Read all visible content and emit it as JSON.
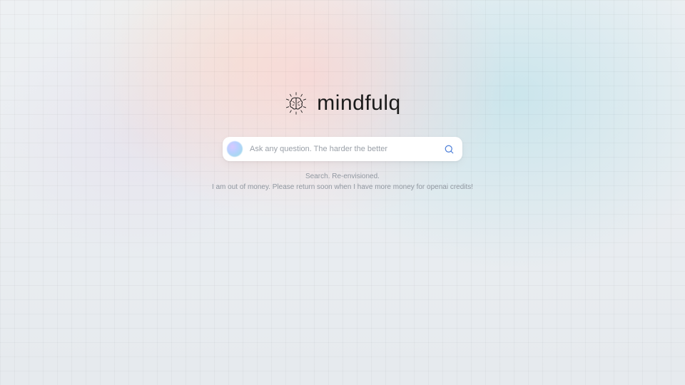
{
  "brand": {
    "name": "mindfulq"
  },
  "search": {
    "placeholder": "Ask any question. The harder the better",
    "value": ""
  },
  "tagline": {
    "line1": "Search. Re-envisioned.",
    "line2": "I am out of money. Please return soon when I have more money for openai credits!"
  },
  "icons": {
    "brain": "brain-icon",
    "orb": "orb-icon",
    "search": "search-icon"
  }
}
